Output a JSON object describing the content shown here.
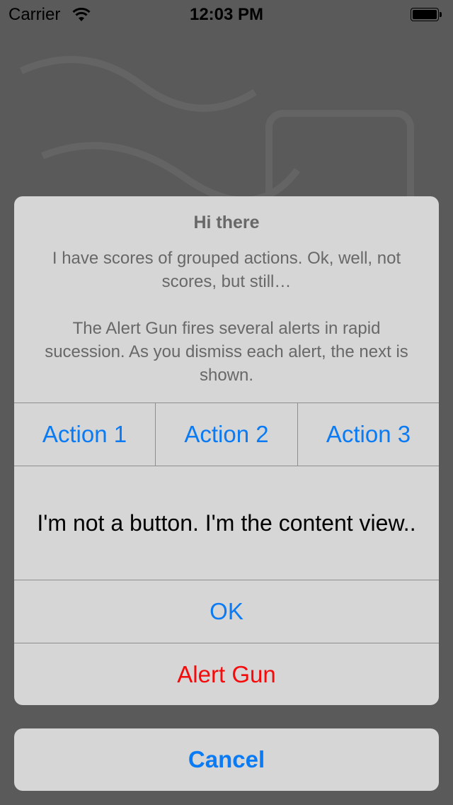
{
  "status_bar": {
    "carrier": "Carrier",
    "time": "12:03 PM",
    "icons": [
      "wifi-icon",
      "battery-icon"
    ]
  },
  "alert": {
    "title": "Hi there",
    "message_lines": [
      "I have scores of grouped actions. Ok, well, not scores, but still…",
      "The Alert Gun fires several alerts in rapid sucession. As you dismiss each alert, the next is shown."
    ],
    "grouped_actions": [
      "Action 1",
      "Action 2",
      "Action 3"
    ],
    "content_view_text": "I'm not a button. I'm the content view..",
    "ok_label": "OK",
    "alert_gun_label": "Alert Gun"
  },
  "cancel_label": "Cancel",
  "colors": {
    "action_blue": "#0a7bf4",
    "destructive_red": "#f40c0c",
    "sheet_background": "#d6d6d6",
    "dim_overlay": "#5a5a5a"
  }
}
